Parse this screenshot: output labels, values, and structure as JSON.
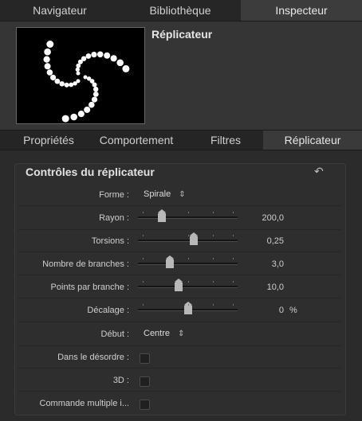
{
  "top_tabs": [
    "Navigateur",
    "Bibliothèque",
    "Inspecteur"
  ],
  "preview": {
    "title": "Réplicateur"
  },
  "sub_tabs": [
    "Propriétés",
    "Comportement",
    "Filtres",
    "Réplicateur"
  ],
  "section": {
    "title": "Contrôles du réplicateur"
  },
  "controls": {
    "forme": {
      "label": "Forme :",
      "value": "Spirale",
      "arrows": "⇕"
    },
    "rayon": {
      "label": "Rayon :",
      "value": "200,0",
      "level": 0.24
    },
    "torsions": {
      "label": "Torsions :",
      "value": "0,25",
      "level": 0.56
    },
    "branches": {
      "label": "Nombre de branches :",
      "value": "3,0",
      "level": 0.32
    },
    "points": {
      "label": "Points par branche :",
      "value": "10,0",
      "level": 0.41
    },
    "decalage": {
      "label": "Décalage :",
      "value": "0",
      "unit": "%",
      "level": 0.5
    },
    "debut": {
      "label": "Début :",
      "value": "Centre",
      "arrows": "⇕"
    },
    "desordre": {
      "label": "Dans le désordre :",
      "checked": false
    },
    "threed": {
      "label": "3D :",
      "checked": false
    },
    "multiple": {
      "label": "Commande multiple i...",
      "checked": false
    }
  },
  "colors": {
    "background": "#2b2b2b",
    "panel": "#2e2e2e",
    "active_tab": "#3c3c3c"
  }
}
